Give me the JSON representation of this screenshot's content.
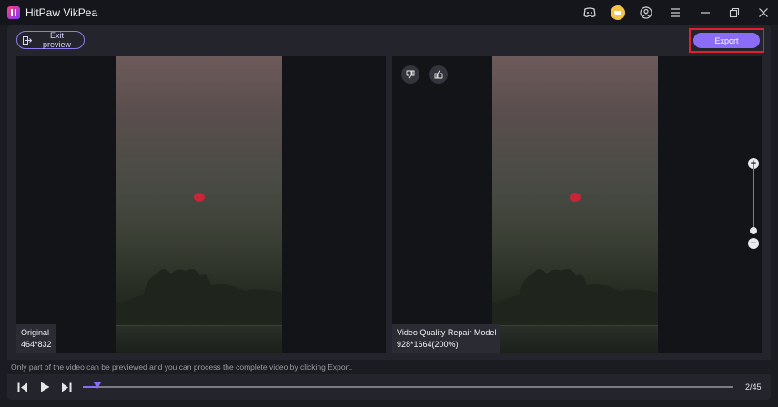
{
  "app": {
    "title": "HitPaw VikPea"
  },
  "titlebar_icons": [
    "discord-icon",
    "shop-icon",
    "account-icon",
    "menu-icon",
    "minimize-icon",
    "restore-icon",
    "close-icon"
  ],
  "toolbar": {
    "exit_label": "Exit preview",
    "export_label": "Export"
  },
  "original": {
    "label": "Original",
    "resolution": "464*832"
  },
  "enhanced": {
    "label": "Video Quality Repair Model",
    "resolution": "928*1664(200%)"
  },
  "hint": "Only part of the video can be previewed and you can process the complete video by clicking Export.",
  "player": {
    "frame": "2/45",
    "progress": 0.022
  },
  "colors": {
    "accent": "#8a6cf7",
    "highlight": "#e0202e"
  }
}
